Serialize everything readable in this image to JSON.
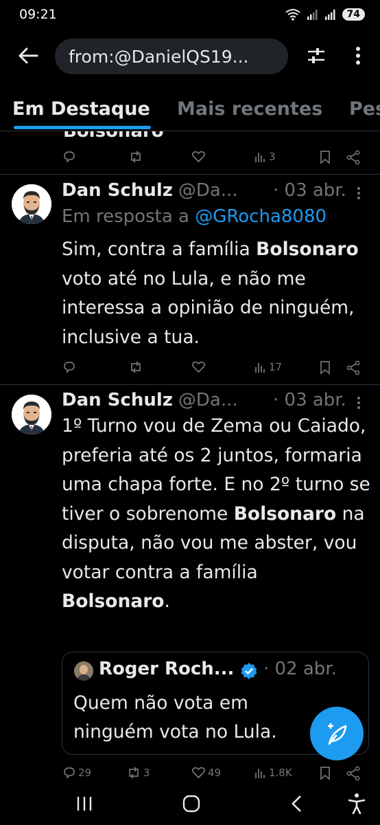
{
  "status": {
    "time": "09:21",
    "battery": "74"
  },
  "header": {
    "search_value": "from:@DanielQS19..."
  },
  "tabs": [
    "Em Destaque",
    "Mais recentes",
    "Pes"
  ],
  "prev_tweet": {
    "cut_text": "Bolsonaro",
    "views": "3"
  },
  "tweet1": {
    "name": "Dan Schulz",
    "handle": "@Da...",
    "date": "· 03 abr.",
    "reply_prefix": "Em resposta a ",
    "reply_mention": "@GRocha8080",
    "text_1": "Sim, contra a família ",
    "bold_1": "Bolsonaro",
    "text_2": " voto até no Lula, e não me interessa a opinião de ninguém, inclusive a tua.",
    "views": "17"
  },
  "tweet2": {
    "name": "Dan Schulz",
    "handle": "@Da...",
    "date": "· 03 abr.",
    "text_1": "1º Turno vou de Zema ou Caiado, preferia até os 2 juntos, formaria uma chapa forte. E no 2º turno se tiver o sobrenome ",
    "bold_1": "Bolsonaro",
    "text_2": " na disputa, não vou me abster, vou votar contra a família ",
    "bold_2": "Bolsonaro",
    "text_3": ".",
    "quote": {
      "name": "Roger Roch...",
      "date": "· 02 abr.",
      "text": "Quem não vota em ninguém vota no Lula."
    },
    "replies": "29",
    "retweets": "3",
    "likes": "49",
    "views": "1.8K"
  },
  "colors": {
    "accent": "#1d9bf0",
    "text": "#e7e9ea",
    "muted": "#71767b",
    "background": "#000000"
  },
  "icons": [
    "back-arrow-icon",
    "tune-icon",
    "more-vertical-icon",
    "reply-icon",
    "retweet-icon",
    "like-icon",
    "views-icon",
    "bookmark-icon",
    "share-icon",
    "verified-icon",
    "compose-icon",
    "recents-icon",
    "home-icon",
    "nav-back-icon",
    "accessibility-icon"
  ]
}
